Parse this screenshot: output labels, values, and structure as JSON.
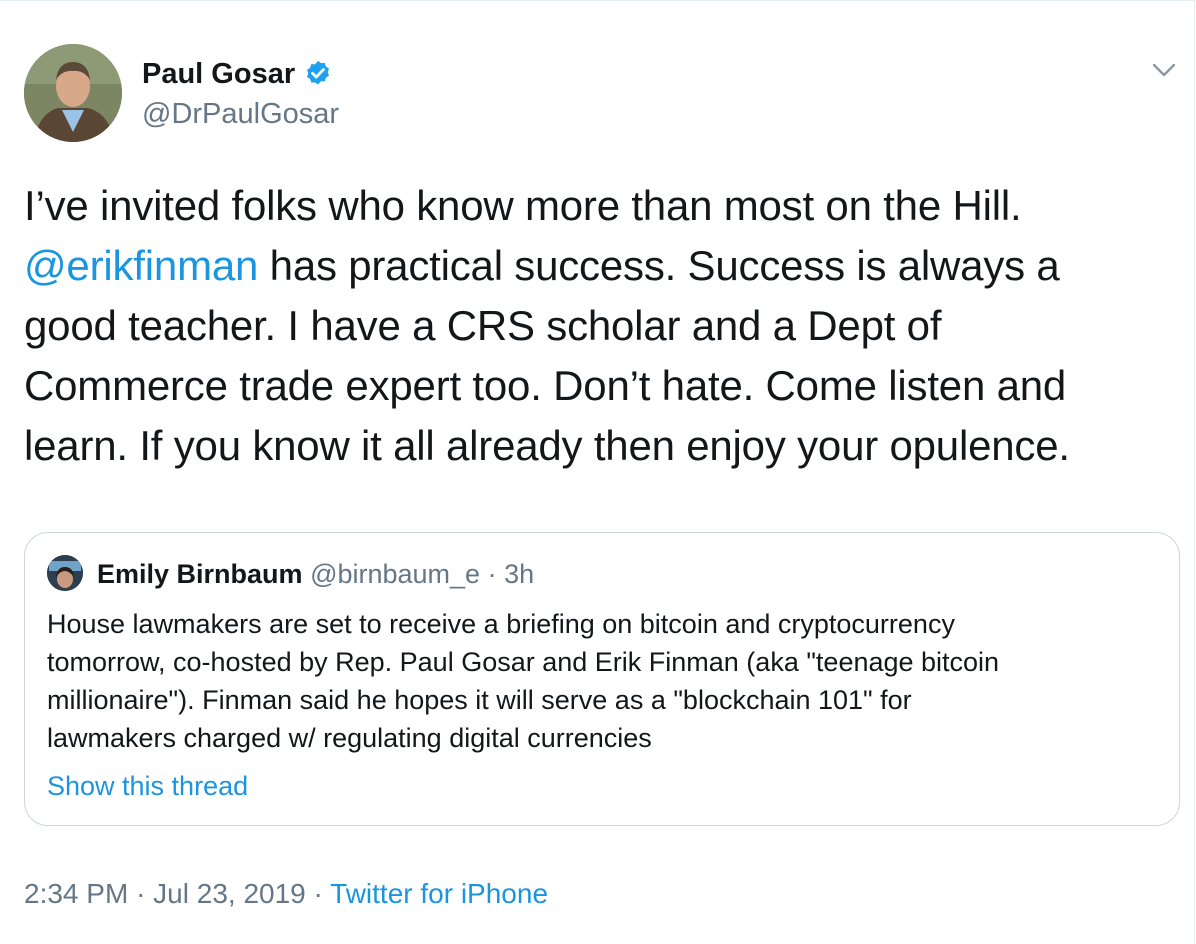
{
  "author": {
    "name": "Paul Gosar",
    "handle": "@DrPaulGosar",
    "verified": true
  },
  "tweet": {
    "lines": [
      {
        "mention": "",
        "text": "I’ve invited folks who know more than most on the Hill."
      },
      {
        "mention": "@erikfinman",
        "text": " has practical success.  Success is always a"
      },
      {
        "mention": "",
        "text": "good teacher. I have a CRS scholar and a Dept of"
      },
      {
        "mention": "",
        "text": "Commerce trade expert too.  Don’t hate. Come listen and"
      },
      {
        "mention": "",
        "text": "learn. If you know it all already then enjoy your opulence."
      }
    ]
  },
  "quoted": {
    "name": "Emily Birnbaum",
    "handle": "@birnbaum_e",
    "separator": "·",
    "time": "3h",
    "lines": [
      "House lawmakers are set to receive a briefing on bitcoin and cryptocurrency",
      "tomorrow, co-hosted by Rep. Paul Gosar and Erik Finman (aka \"teenage bitcoin",
      "millionaire\"). Finman said he hopes it will serve as a \"blockchain 101\" for",
      "lawmakers charged w/ regulating digital currencies"
    ],
    "show_thread": "Show this thread"
  },
  "meta": {
    "time": "2:34 PM",
    "sep1": "·",
    "date": "Jul 23, 2019",
    "sep2": "·",
    "source": "Twitter for iPhone"
  },
  "colors": {
    "link": "#1b95e0",
    "secondary": "#657786",
    "border": "#ccd6dd",
    "verified": "#1da1f2"
  }
}
